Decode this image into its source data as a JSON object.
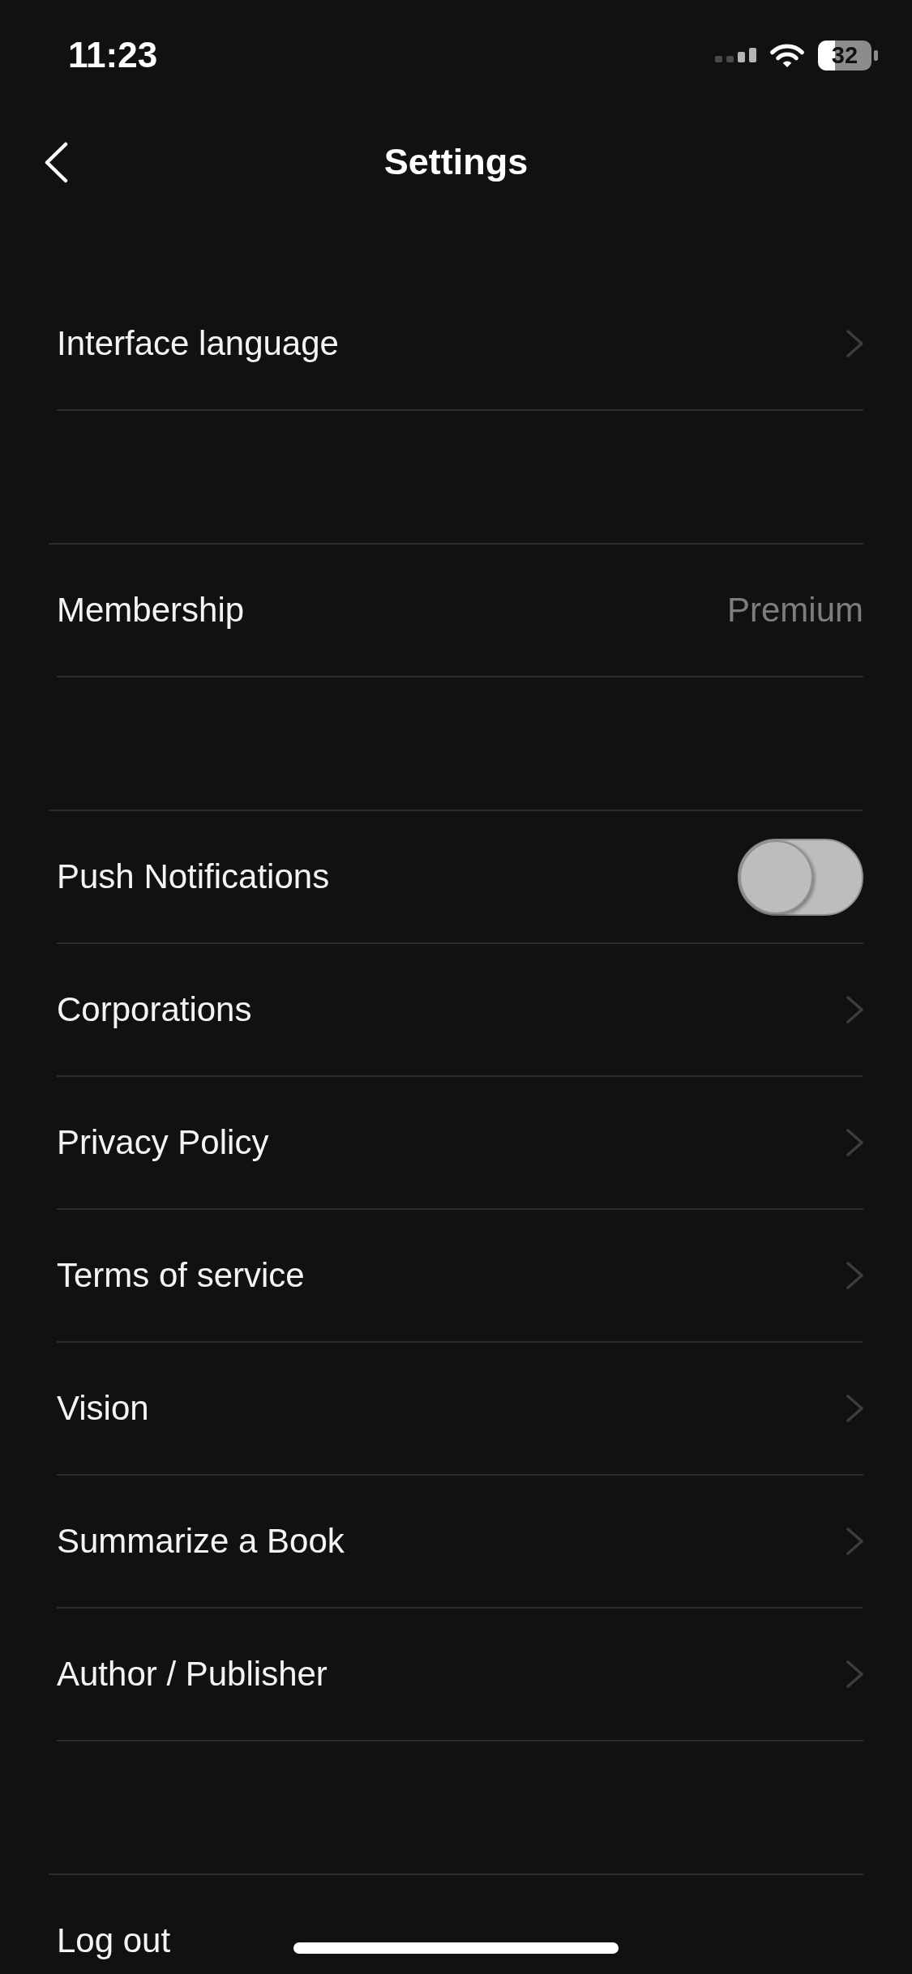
{
  "status_bar": {
    "time": "11:23",
    "battery": "32"
  },
  "header": {
    "title": "Settings"
  },
  "sections": [
    {
      "items": [
        {
          "kind": "link",
          "label": "Interface language"
        }
      ]
    },
    {
      "items": [
        {
          "kind": "value",
          "label": "Membership",
          "value": "Premium"
        }
      ]
    },
    {
      "items": [
        {
          "kind": "toggle",
          "label": "Push Notifications",
          "on": false
        },
        {
          "kind": "link",
          "label": "Corporations"
        },
        {
          "kind": "link",
          "label": "Privacy Policy"
        },
        {
          "kind": "link",
          "label": "Terms of service"
        },
        {
          "kind": "link",
          "label": "Vision"
        },
        {
          "kind": "link",
          "label": "Summarize a Book"
        },
        {
          "kind": "link",
          "label": "Author / Publisher"
        }
      ]
    },
    {
      "items": [
        {
          "kind": "action",
          "label": "Log out"
        }
      ]
    }
  ]
}
